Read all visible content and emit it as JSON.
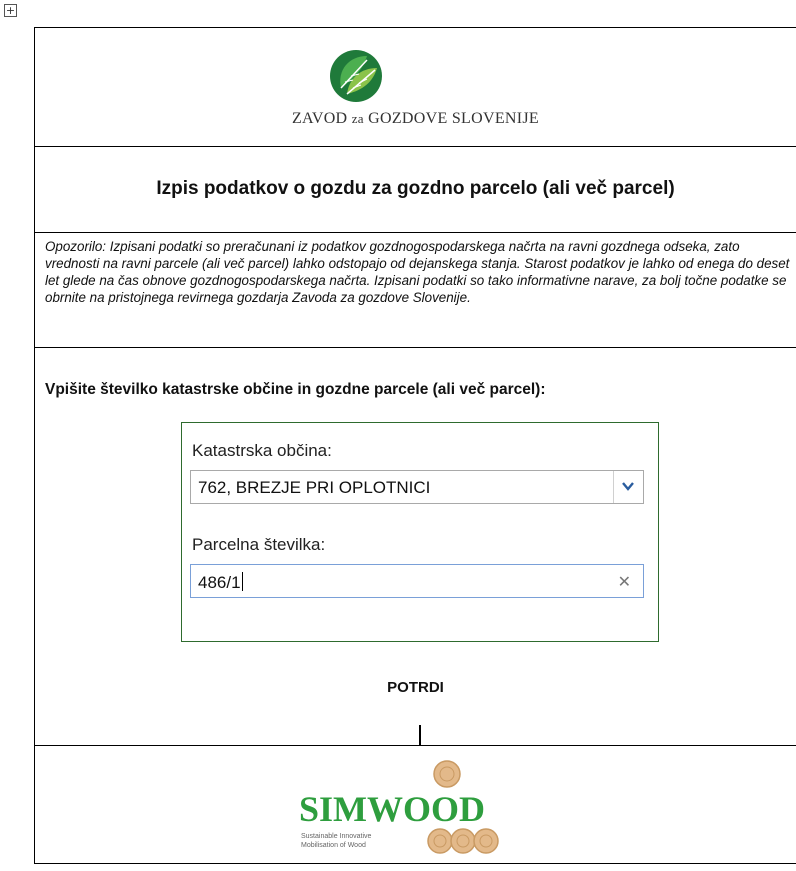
{
  "header": {
    "org_name_part1": "ZAVOD ",
    "org_name_small": "za",
    "org_name_part2": " GOZDOVE SLOVENIJE",
    "logo_icon": "zgs-leaf-logo-icon",
    "brand_color": "#2e7d32"
  },
  "page": {
    "title": "Izpis podatkov o gozdu za gozdno parcelo (ali več parcel)",
    "warning": "Opozorilo: Izpisani podatki so preračunani iz podatkov gozdnogospodarskega načrta na ravni gozdnega odseka, zato vrednosti na ravni parcele (ali več parcel) lahko odstopajo od dejanskega stanja. Starost podatkov je lahko od enega do deset let glede na čas obnove gozdnogospodarskega načrta. Izpisani podatki so tako informativne narave, za bolj točne podatke se obrnite na pristojnega revirnega gozdarja Zavoda za gozdove Slovenije."
  },
  "form": {
    "instruction": "Vpišite številko katastrske občine in gozdne parcele (ali več parcel):",
    "cadastral_label": "Katastrska občina:",
    "cadastral_value": "762, BREZJE PRI OPLOTNICI",
    "parcel_label": "Parcelna številka:",
    "parcel_value": "486/1",
    "confirm_label": "POTRDI",
    "panel_border_color": "#2e6b2e"
  },
  "footer": {
    "logo_text": "SIMWOOD",
    "logo_sub_line1": "Sustainable Innovative",
    "logo_sub_line2": "Mobilisation of Wood",
    "logo_color": "#2e9e3e"
  }
}
